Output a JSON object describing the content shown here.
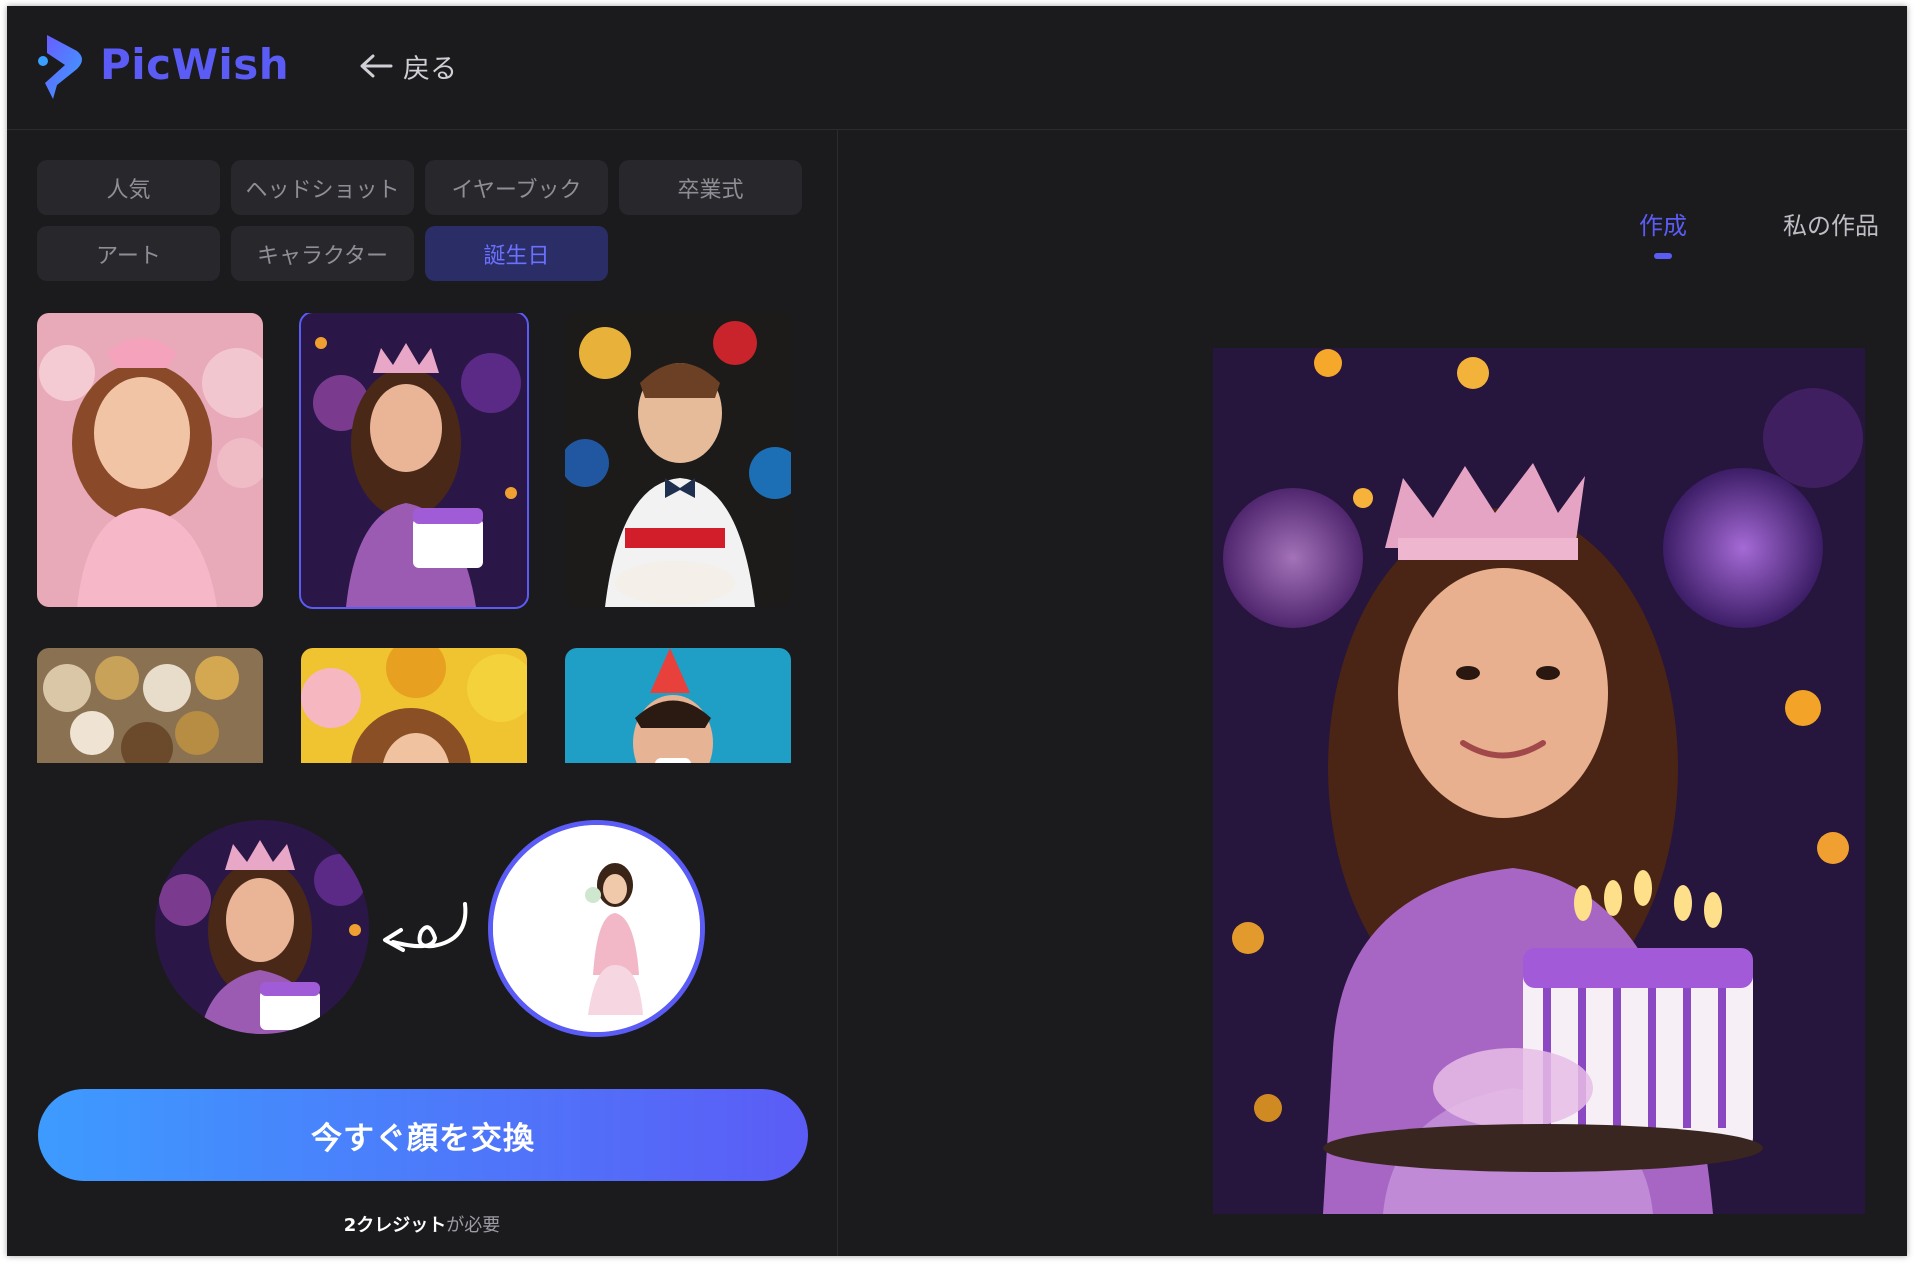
{
  "app": {
    "brand": "PicWish",
    "back_label": "戻る"
  },
  "categories": [
    {
      "label": "人気"
    },
    {
      "label": "ヘッドショット"
    },
    {
      "label": "イヤーブック"
    },
    {
      "label": "卒業式"
    },
    {
      "label": "アート"
    },
    {
      "label": "キャラクター"
    },
    {
      "label": "誕生日",
      "active": true
    }
  ],
  "templates": [
    {
      "name": "girl-pink-balloons"
    },
    {
      "name": "girl-crown-purple-cake",
      "selected": true
    },
    {
      "name": "boy-bowtie-cake"
    },
    {
      "name": "gold-balloons"
    },
    {
      "name": "girl-yellow-balloons"
    },
    {
      "name": "man-party-hat-blue"
    }
  ],
  "swap": {
    "target": "girl-crown-purple-cake",
    "source": "girl-white-background"
  },
  "cta": {
    "label": "今すぐ顔を交換"
  },
  "credit": {
    "amount": "2クレジット",
    "suffix": "が必要"
  },
  "right_tabs": [
    {
      "label": "作成",
      "active": true
    },
    {
      "label": "私の作品"
    }
  ],
  "colors": {
    "accent": "#5b5cf6",
    "background": "#1b1b1d",
    "tab_bg": "#28282c",
    "cta_start": "#3d9bff",
    "cta_end": "#5b5cf6"
  }
}
